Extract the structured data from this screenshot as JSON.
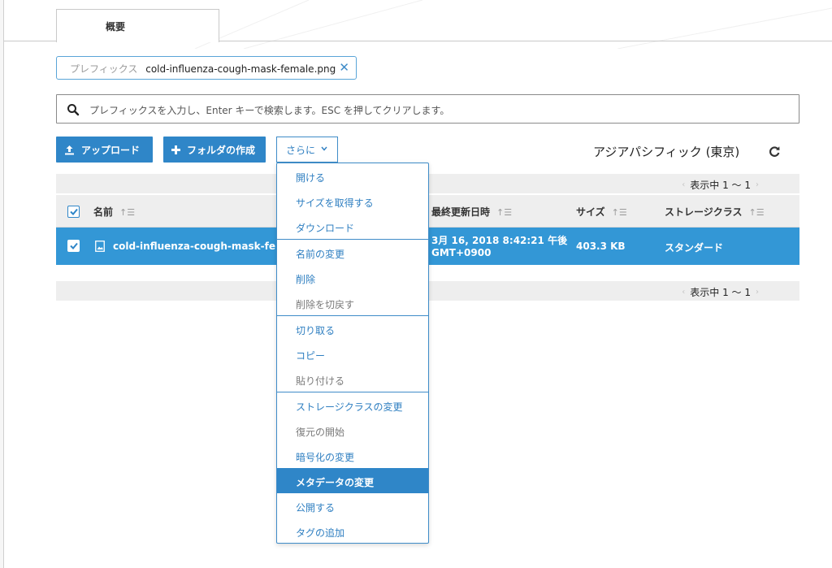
{
  "tabs": [
    {
      "label": "概要"
    }
  ],
  "filter_chip": {
    "key": "プレフィックス",
    "value": "cold-influenza-cough-mask-female.png"
  },
  "search": {
    "placeholder": "プレフィックスを入力し、Enter キーで検索します。ESC を押してクリアします。"
  },
  "toolbar": {
    "upload_label": "アップロード",
    "create_folder_label": "フォルダの作成",
    "more_label": "さらに"
  },
  "region": "アジアパシフィック (東京)",
  "pagination": {
    "top": "表示中 1 〜 1",
    "bottom": "表示中 1 〜 1"
  },
  "table": {
    "columns": [
      "名前",
      "最終更新日時",
      "サイズ",
      "ストレージクラス"
    ],
    "rows": [
      {
        "name": "cold-influenza-cough-mask-female",
        "modified_line1": "3月 16, 2018 8:42:21 午後",
        "modified_line2": "GMT+0900",
        "size": "403.3 KB",
        "storage_class": "スタンダード",
        "selected": true
      }
    ]
  },
  "more_menu": {
    "items": [
      {
        "label": "開ける",
        "state": "enabled"
      },
      {
        "label": "サイズを取得する",
        "state": "enabled"
      },
      {
        "label": "ダウンロード",
        "state": "enabled"
      },
      {
        "label": "名前の変更",
        "state": "enabled"
      },
      {
        "label": "削除",
        "state": "enabled"
      },
      {
        "label": "削除を切戻す",
        "state": "disabled"
      },
      {
        "label": "切り取る",
        "state": "enabled"
      },
      {
        "label": "コピー",
        "state": "enabled"
      },
      {
        "label": "貼り付ける",
        "state": "disabled"
      },
      {
        "label": "ストレージクラスの変更",
        "state": "enabled"
      },
      {
        "label": "復元の開始",
        "state": "disabled"
      },
      {
        "label": "暗号化の変更",
        "state": "enabled"
      },
      {
        "label": "メタデータの変更",
        "state": "highlighted"
      },
      {
        "label": "公開する",
        "state": "enabled"
      },
      {
        "label": "タグの追加",
        "state": "enabled"
      }
    ]
  },
  "colors": {
    "accent": "#2f86c8",
    "selected_row": "#3397d6",
    "header_bg": "#eeeeee"
  },
  "icons": [
    "close-icon",
    "search-icon",
    "upload-icon",
    "plus-icon",
    "chevron-down-icon",
    "refresh-icon",
    "checkbox-checked-icon",
    "sort-icon",
    "image-file-icon"
  ]
}
